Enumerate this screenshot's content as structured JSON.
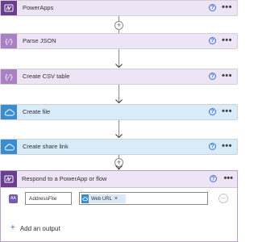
{
  "steps": [
    {
      "title": "PowerApps",
      "help": "?",
      "more": "•••"
    },
    {
      "title": "Parse JSON",
      "help": "?",
      "more": "•••"
    },
    {
      "title": "Create CSV table",
      "help": "?",
      "more": "•••"
    },
    {
      "title": "Create file",
      "help": "?",
      "more": "•••"
    },
    {
      "title": "Create share link",
      "help": "?",
      "more": "•••"
    }
  ],
  "respond_card": {
    "title": "Respond to a PowerApp or flow",
    "help": "?",
    "more": "•••",
    "output": {
      "avatar_text": "AA",
      "name_value": "AddressFile",
      "token_label": "Web URL",
      "token_remove": "×",
      "options_label": "…"
    },
    "add_output_icon": "+",
    "add_output_label": "Add an output"
  },
  "icons": {
    "powerapps": "powerapps-icon",
    "data_operation": "braces-icon",
    "onedrive": "cloud-icon"
  },
  "colors": {
    "purple_step": "#ede4f5",
    "blue_step": "#d8ebf8",
    "accent": "#3a6fd8"
  }
}
